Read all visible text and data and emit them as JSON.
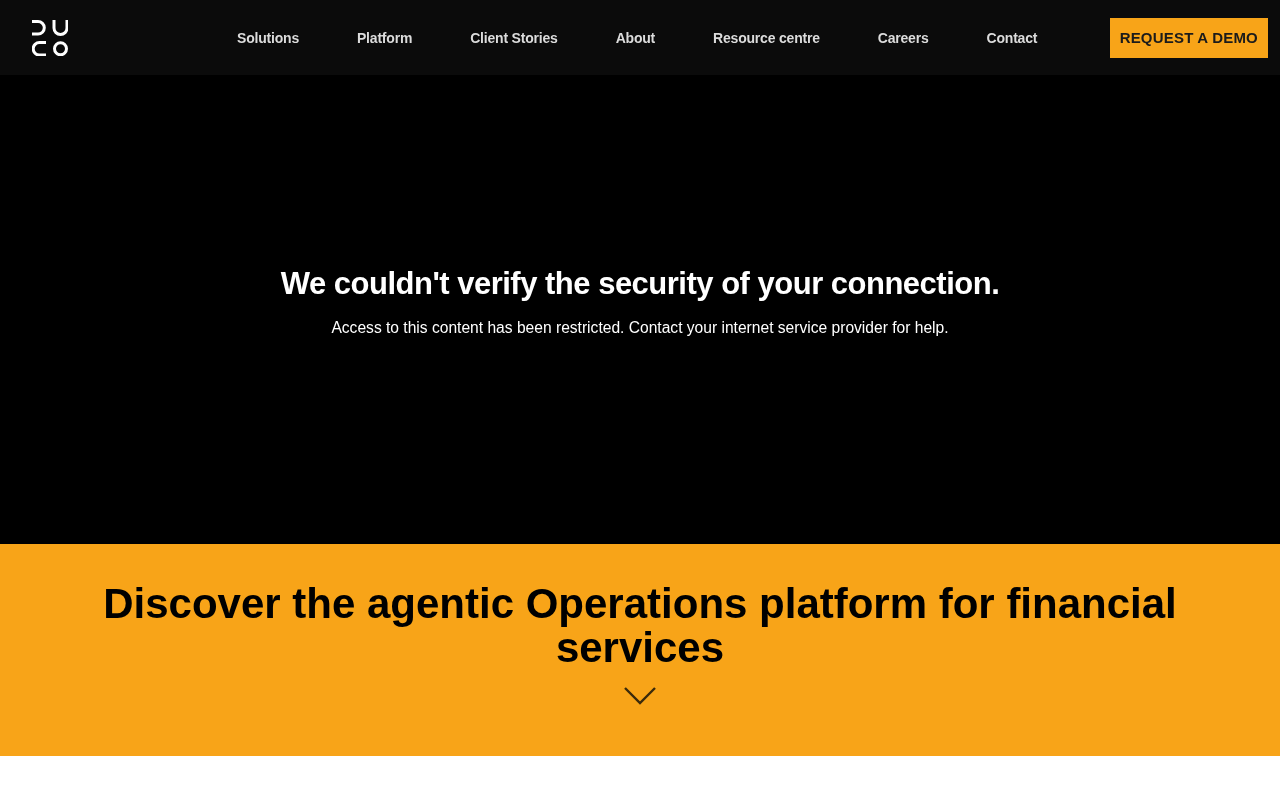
{
  "header": {
    "nav": [
      {
        "label": "Solutions"
      },
      {
        "label": "Platform"
      },
      {
        "label": "Client Stories"
      },
      {
        "label": "About"
      },
      {
        "label": "Resource centre"
      },
      {
        "label": "Careers"
      },
      {
        "label": "Contact"
      }
    ],
    "cta": "REQUEST A DEMO"
  },
  "notice": {
    "title": "We couldn't verify the security of your connection.",
    "message": "Access to this content has been restricted. Contact your internet service provider for help."
  },
  "banner": {
    "heading": "Discover the agentic Operations platform for financial services"
  }
}
